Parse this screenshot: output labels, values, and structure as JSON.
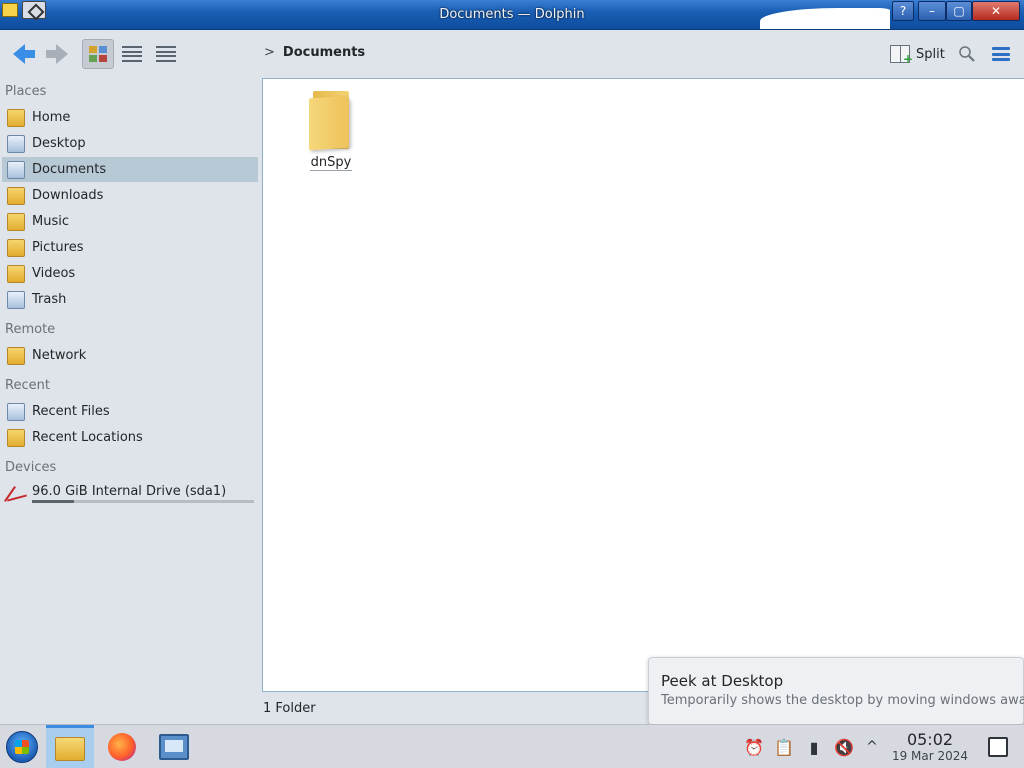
{
  "window": {
    "title": "Documents — Dolphin"
  },
  "titlebar_buttons": {
    "help": "?",
    "minimize": "–",
    "maximize": "▢",
    "close": "✕"
  },
  "toolbar": {
    "breadcrumb_chevron": ">",
    "breadcrumb_label": "Documents",
    "split_label": "Split",
    "icons": {
      "back": "back-arrow-icon",
      "forward": "forward-arrow-icon",
      "icons_view": "icons-view-icon",
      "compact_view": "compact-view-icon",
      "details_view": "details-view-icon",
      "split": "split-view-icon",
      "search": "search-icon",
      "menu": "hamburger-menu-icon"
    },
    "active_view": "icons"
  },
  "sidebar": {
    "sections": {
      "places": "Places",
      "remote": "Remote",
      "recent": "Recent",
      "devices": "Devices"
    },
    "places": [
      {
        "label": "Home",
        "icon": "home-folder-icon"
      },
      {
        "label": "Desktop",
        "icon": "desktop-icon"
      },
      {
        "label": "Documents",
        "icon": "documents-folder-icon",
        "active": true
      },
      {
        "label": "Downloads",
        "icon": "downloads-folder-icon"
      },
      {
        "label": "Music",
        "icon": "music-folder-icon"
      },
      {
        "label": "Pictures",
        "icon": "pictures-folder-icon"
      },
      {
        "label": "Videos",
        "icon": "videos-folder-icon"
      },
      {
        "label": "Trash",
        "icon": "trash-icon"
      }
    ],
    "remote": [
      {
        "label": "Network",
        "icon": "network-folder-icon"
      }
    ],
    "recent": [
      {
        "label": "Recent Files",
        "icon": "recent-files-icon"
      },
      {
        "label": "Recent Locations",
        "icon": "recent-locations-icon"
      }
    ],
    "devices": [
      {
        "label": "96.0 GiB Internal Drive (sda1)",
        "icon": "drive-icon",
        "usage_fraction": 0.19
      }
    ]
  },
  "main": {
    "items": [
      {
        "name": "dnSpy",
        "type": "folder",
        "icon": "folder-icon"
      }
    ]
  },
  "status": {
    "text": "1 Folder"
  },
  "tooltip": {
    "title": "Peek at Desktop",
    "subtitle": "Temporarily shows the desktop by moving windows away"
  },
  "taskbar": {
    "clock_time": "05:02",
    "clock_date": "19 Mar 2024",
    "tray_icons": [
      "alarm-icon",
      "clipboard-icon",
      "battery-icon",
      "volume-muted-icon",
      "expand-tray-icon"
    ],
    "tray_glyphs": {
      "alarm": "⏰",
      "clipboard": "📋",
      "battery": "▮",
      "volume": "🔇",
      "expand": "^"
    }
  }
}
